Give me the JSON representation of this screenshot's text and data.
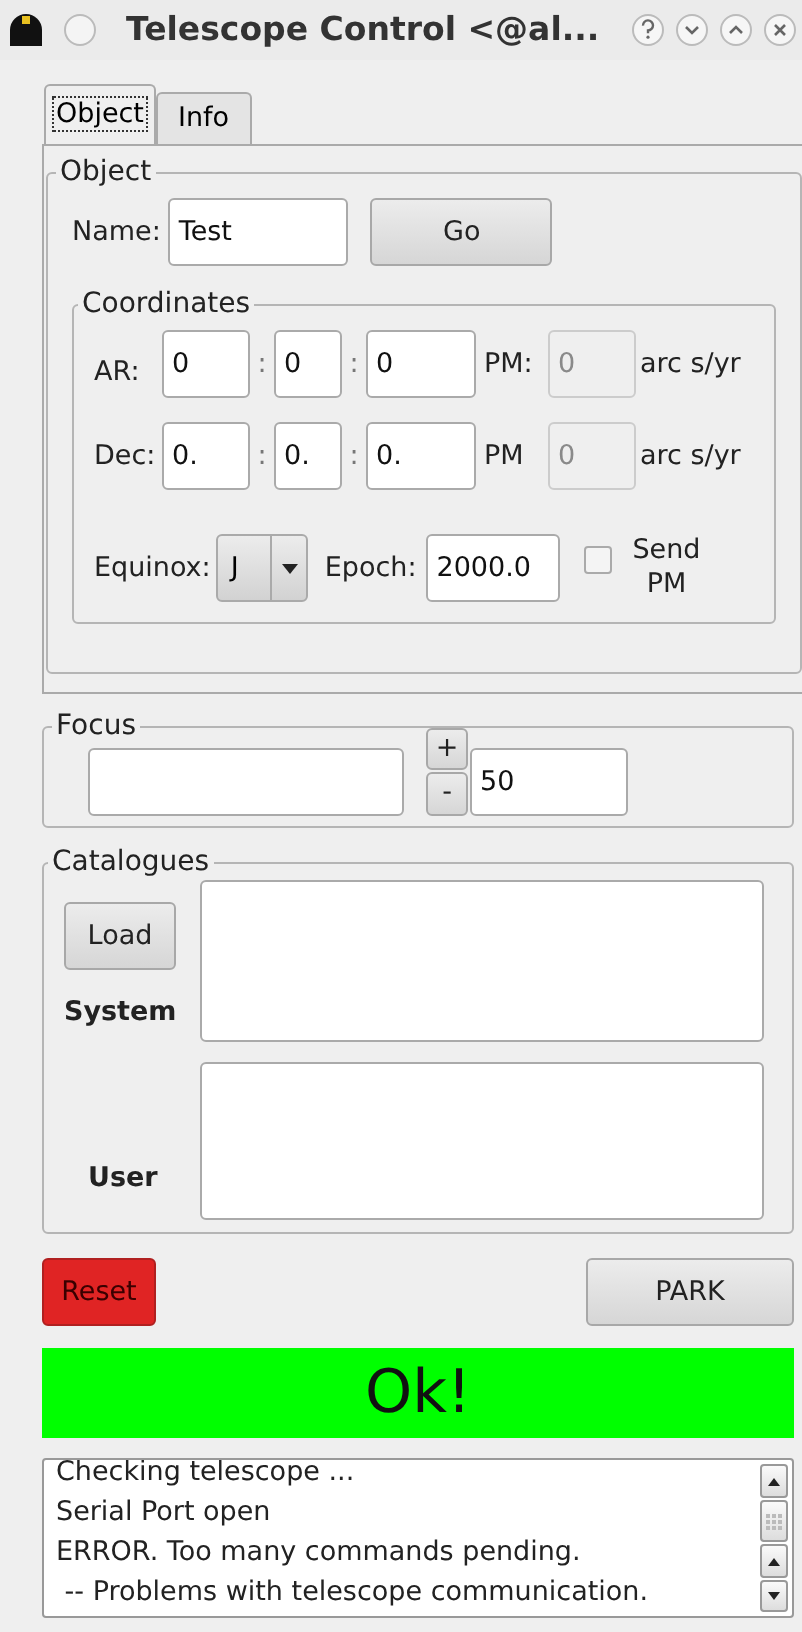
{
  "window": {
    "title": "Telescope Control <@al..."
  },
  "tabs": [
    {
      "label": "Object",
      "selected": true
    },
    {
      "label": "Info",
      "selected": false
    }
  ],
  "object_group": {
    "title": "Object",
    "name_label": "Name:",
    "name_value": "Test",
    "go_button": "Go",
    "coordinates": {
      "title": "Coordinates",
      "rows": [
        {
          "label": "AR:",
          "fields": [
            "0",
            "0",
            "0"
          ],
          "separators": [
            ":",
            ":"
          ],
          "pm_label": "PM:",
          "pm": {
            "value": "0",
            "disabled": true
          },
          "unit": "arc s/yr"
        },
        {
          "label": "Dec:",
          "fields": [
            "0.",
            "0.",
            "0."
          ],
          "separators": [
            ":",
            ":"
          ],
          "pm_label": "PM",
          "pm": {
            "value": "0",
            "disabled": true
          },
          "unit": "arc s/yr"
        }
      ],
      "equinox_label": "Equinox:",
      "equinox_value": "J",
      "epoch_label": "Epoch:",
      "epoch_value": "2000.0",
      "send_pm": {
        "label": "Send PM",
        "checked": false
      }
    }
  },
  "focus": {
    "title": "Focus",
    "step_up": "+",
    "step_down": "-",
    "step_value": "50"
  },
  "catalogues": {
    "title": "Catalogues",
    "load_button": "Load",
    "system_label": "System",
    "user_label": "User"
  },
  "reset_button": "Reset",
  "park_button": "PARK",
  "status": {
    "text": "Ok!",
    "color": "#00ff00"
  },
  "log": [
    "Checking telescope ...",
    "Serial Port open",
    "ERROR. Too many commands pending.",
    " -- Problems with telescope communication."
  ]
}
